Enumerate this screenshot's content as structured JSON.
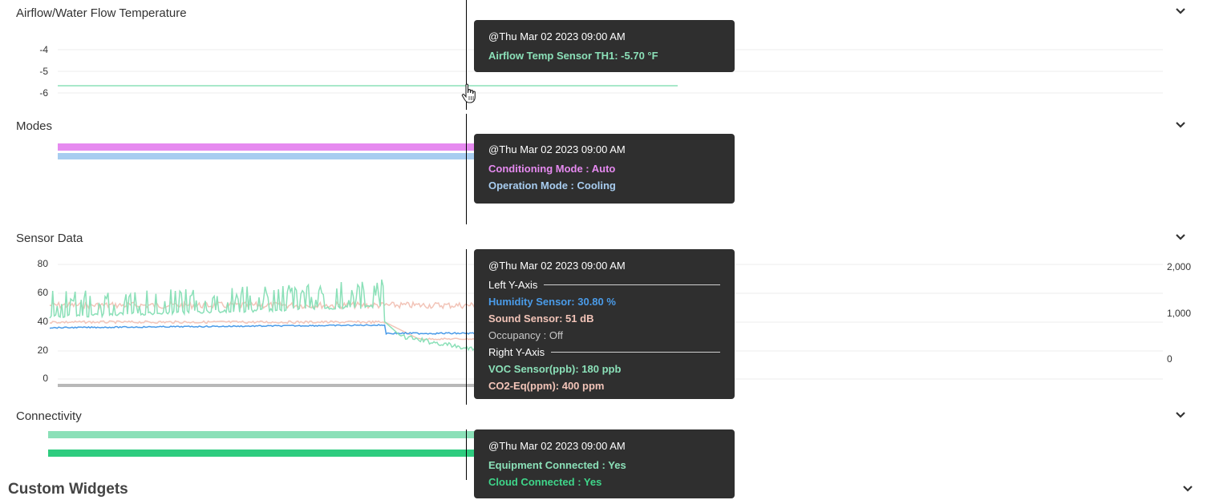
{
  "sections": {
    "airflow": {
      "title": "Airflow/Water Flow Temperature",
      "y_ticks": [
        "-4",
        "-5",
        "-6"
      ],
      "tooltip": {
        "timestamp": "@Thu Mar 02 2023 09:00 AM",
        "rows": [
          {
            "text": "Airflow Temp Sensor TH1: -5.70 °F",
            "color": "#8be0b8"
          }
        ]
      }
    },
    "modes": {
      "title": "Modes",
      "tooltip": {
        "timestamp": "@Thu Mar 02 2023 09:00 AM",
        "rows": [
          {
            "text": "Conditioning Mode : Auto",
            "color": "#e68af0"
          },
          {
            "text": "Operation Mode : Cooling",
            "color": "#a8cdf0"
          }
        ]
      }
    },
    "sensor": {
      "title": "Sensor Data",
      "left_ticks": [
        "80",
        "60",
        "40",
        "20",
        "0"
      ],
      "right_ticks": [
        "2,000",
        "1,000",
        "0"
      ],
      "tooltip": {
        "timestamp": "@Thu Mar 02 2023 09:00 AM",
        "left_group": "Left Y-Axis",
        "left_rows": [
          {
            "text": "Humidity Sensor: 30.80 %",
            "color": "#4a9be8",
            "bold": true
          },
          {
            "text": "Sound Sensor: 51 dB",
            "color": "#f2c4b8",
            "bold": true
          },
          {
            "text": "Occupancy : Off",
            "color": "#c8c8c8",
            "bold": false
          }
        ],
        "right_group": "Right Y-Axis",
        "right_rows": [
          {
            "text": "VOC Sensor(ppb): 180 ppb",
            "color": "#8be0b8",
            "bold": true
          },
          {
            "text": "CO2-Eq(ppm): 400 ppm",
            "color": "#f2c4b8",
            "bold": true
          }
        ]
      }
    },
    "connectivity": {
      "title": "Connectivity",
      "tooltip": {
        "timestamp": "@Thu Mar 02 2023 09:00 AM",
        "rows": [
          {
            "text": "Equipment Connected : Yes",
            "color": "#8be0b8"
          },
          {
            "text": "Cloud Connected : Yes",
            "color": "#3fd68a"
          }
        ]
      }
    }
  },
  "custom_widgets": {
    "title": "Custom Widgets"
  },
  "icons": {
    "collapse": "chevron-down-icon",
    "cursor": "hand-pointer-icon"
  },
  "colors": {
    "airflow_line": "#8be0b8",
    "conditioning_mode": "#e68af0",
    "operation_mode": "#a8cdf0",
    "humidity": "#4a9be8",
    "sound": "#f2c4b8",
    "voc": "#8be0b8",
    "occupancy": "#b8b8b8",
    "equipment_connected": "#8be0b8",
    "cloud_connected": "#2ecc7f",
    "tooltip_bg": "#2f2f2f"
  }
}
